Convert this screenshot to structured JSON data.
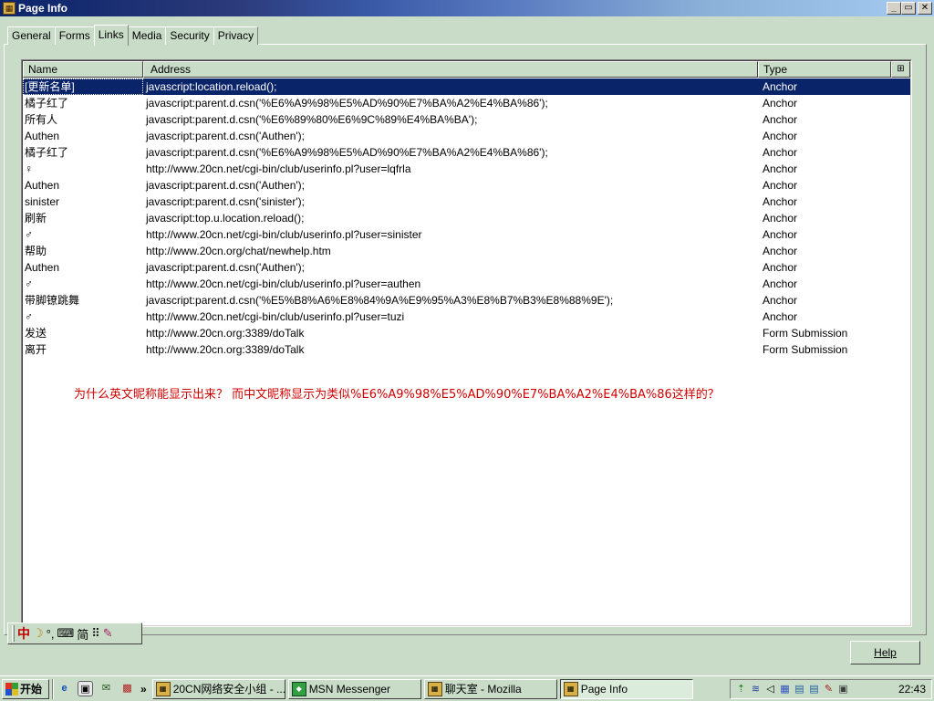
{
  "window": {
    "title": "Page Info",
    "icon": "page-info-icon",
    "controls": {
      "minimize": "_",
      "maximize": "▭",
      "close": "✕"
    }
  },
  "tabs": [
    {
      "label": "General",
      "active": false
    },
    {
      "label": "Forms",
      "active": false
    },
    {
      "label": "Links",
      "active": true
    },
    {
      "label": "Media",
      "active": false
    },
    {
      "label": "Security",
      "active": false
    },
    {
      "label": "Privacy",
      "active": false
    }
  ],
  "links_table": {
    "columns": [
      "Name",
      "Address",
      "Type"
    ],
    "column_picker_icon": "⊞",
    "rows": [
      {
        "name": "[更新名单]",
        "address": "javascript:location.reload();",
        "type": "Anchor",
        "selected": true
      },
      {
        "name": "橘子红了",
        "address": "javascript:parent.d.csn('%E6%A9%98%E5%AD%90%E7%BA%A2%E4%BA%86');",
        "type": "Anchor"
      },
      {
        "name": "所有人",
        "address": "javascript:parent.d.csn('%E6%89%80%E6%9C%89%E4%BA%BA');",
        "type": "Anchor"
      },
      {
        "name": "Authen",
        "address": "javascript:parent.d.csn('Authen');",
        "type": "Anchor"
      },
      {
        "name": "橘子红了",
        "address": "javascript:parent.d.csn('%E6%A9%98%E5%AD%90%E7%BA%A2%E4%BA%86');",
        "type": "Anchor"
      },
      {
        "name": "♀",
        "address": "http://www.20cn.net/cgi-bin/club/userinfo.pl?user=lqfrla",
        "type": "Anchor"
      },
      {
        "name": "Authen",
        "address": "javascript:parent.d.csn('Authen');",
        "type": "Anchor"
      },
      {
        "name": "sinister",
        "address": "javascript:parent.d.csn('sinister');",
        "type": "Anchor"
      },
      {
        "name": "刷新",
        "address": "javascript:top.u.location.reload();",
        "type": "Anchor"
      },
      {
        "name": "♂",
        "address": "http://www.20cn.net/cgi-bin/club/userinfo.pl?user=sinister",
        "type": "Anchor"
      },
      {
        "name": "帮助",
        "address": "http://www.20cn.org/chat/newhelp.htm",
        "type": "Anchor"
      },
      {
        "name": "Authen",
        "address": "javascript:parent.d.csn('Authen');",
        "type": "Anchor"
      },
      {
        "name": "♂",
        "address": "http://www.20cn.net/cgi-bin/club/userinfo.pl?user=authen",
        "type": "Anchor"
      },
      {
        "name": "带脚镣跳舞",
        "address": "javascript:parent.d.csn('%E5%B8%A6%E8%84%9A%E9%95%A3%E8%B7%B3%E8%88%9E');",
        "type": "Anchor"
      },
      {
        "name": "♂",
        "address": "http://www.20cn.net/cgi-bin/club/userinfo.pl?user=tuzi",
        "type": "Anchor"
      },
      {
        "name": "发送",
        "address": "http://www.20cn.org:3389/doTalk",
        "type": "Form Submission"
      },
      {
        "name": "离开",
        "address": "http://www.20cn.org:3389/doTalk",
        "type": "Form Submission"
      }
    ]
  },
  "annotation": "为什么英文昵称能显示出来？ 而中文昵称显示为类似%E6%A9%98%E5%AD%90%E7%BA%A2%E4%BA%86这样的？",
  "ime_bar": {
    "mode": "中",
    "half_width": "☽",
    "punct": "°,",
    "keyboard": "⌨",
    "charset": "简",
    "soft_kb": "⠿",
    "help": "✎"
  },
  "help_button": "Help",
  "taskbar": {
    "start_label": "开始",
    "more": "»",
    "tasks": [
      {
        "label": "20CN网络安全小组 - ...",
        "icon": "mozilla-icon",
        "active": false
      },
      {
        "label": "MSN Messenger",
        "icon": "msn-icon",
        "active": false
      },
      {
        "label": "聊天室 - Mozilla",
        "icon": "mozilla-icon",
        "active": false
      },
      {
        "label": "Page Info",
        "icon": "mozilla-icon",
        "active": true
      }
    ],
    "clock": "22:43"
  },
  "colors": {
    "selection": "#0a246a",
    "annotation": "#d00000",
    "face": "#c8dcc8"
  }
}
